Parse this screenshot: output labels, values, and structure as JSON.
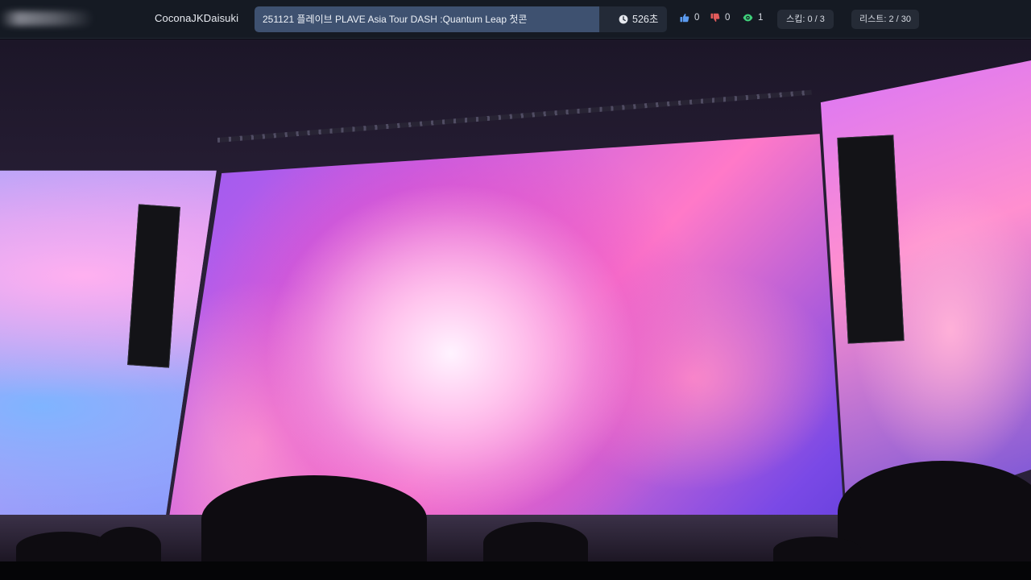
{
  "header": {
    "username": "CoconaJKDaisuki",
    "title": "251121 플레이브 PLAVE Asia Tour DASH :Quantum Leap 첫콘",
    "timer": "526초",
    "likes": "0",
    "dislikes": "0",
    "views": "1",
    "skip": "스킵: 0 / 3",
    "list": "리스트: 2 / 30"
  },
  "icons": {
    "clock": "clock-icon",
    "thumbs_up": "thumbs-up-icon",
    "thumbs_down": "thumbs-down-icon",
    "eye": "eye-icon"
  },
  "colors": {
    "topbar_bg": "#151a23",
    "title_field_bg": "#3e5170",
    "like": "#5b9bf0",
    "dislike": "#e25b5b",
    "views": "#3fd07a"
  }
}
